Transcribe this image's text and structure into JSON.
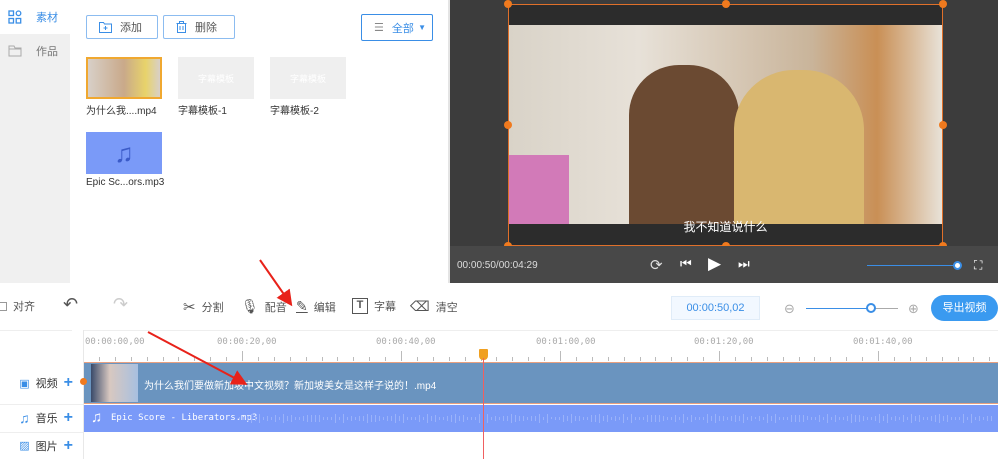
{
  "sidebar": {
    "items": [
      {
        "label": "素材",
        "icon": "grid-icon",
        "active": true
      },
      {
        "label": "作品",
        "icon": "folder-icon",
        "active": false
      }
    ]
  },
  "media": {
    "add_label": "添加",
    "delete_label": "删除",
    "filter_label": "全部",
    "items": [
      {
        "label": "为什么我....mp4",
        "type": "video",
        "selected": true
      },
      {
        "label": "字幕模板-1",
        "type": "subtitle",
        "overlay": "字幕模板"
      },
      {
        "label": "字幕模板-2",
        "type": "subtitle",
        "overlay": "字幕模板"
      },
      {
        "label": "Epic Sc...ors.mp3",
        "type": "audio"
      }
    ]
  },
  "preview": {
    "subtitle": "我不知道说什么",
    "time": "00:00:50/00:04:29",
    "volume": 1.0
  },
  "toolbar": {
    "align_label": "对齐",
    "split_label": "分割",
    "dub_label": "配音",
    "edit_label": "编辑",
    "caption_label": "字幕",
    "clear_label": "清空",
    "timecode": "00:00:50,02",
    "zoom_level": 0.7,
    "export_label": "导出视频"
  },
  "ruler": {
    "labels": [
      "00:00:00,00",
      "00:00:20,00",
      "00:00:40,00",
      "00:01:00,00",
      "00:01:20,00",
      "00:01:40,00"
    ]
  },
  "tracks": {
    "video": {
      "label": "视频",
      "clip": "为什么我们要做新加坡中文视频？新加坡美女是这样子说的！.mp4"
    },
    "music": {
      "label": "音乐",
      "clip": "Epic Score - Liberators.mp3"
    },
    "image": {
      "label": "图片"
    }
  },
  "colors": {
    "accent": "#3a8ee6",
    "playhead": "#f0a020",
    "video_clip": "#6a94bf",
    "audio_clip": "#7a9af8"
  }
}
